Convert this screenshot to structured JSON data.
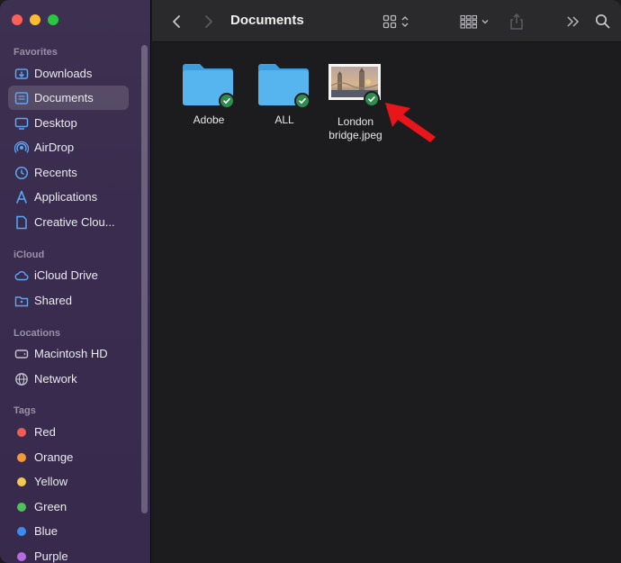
{
  "toolbar": {
    "title": "Documents"
  },
  "sidebar": {
    "sections": {
      "favorites": "Favorites",
      "icloud": "iCloud",
      "locations": "Locations",
      "tags": "Tags"
    },
    "favorites": [
      {
        "label": "Downloads",
        "icon": "download-icon"
      },
      {
        "label": "Documents",
        "icon": "document-icon",
        "selected": true
      },
      {
        "label": "Desktop",
        "icon": "desktop-icon"
      },
      {
        "label": "AirDrop",
        "icon": "airdrop-icon"
      },
      {
        "label": "Recents",
        "icon": "clock-icon"
      },
      {
        "label": "Applications",
        "icon": "applications-icon"
      },
      {
        "label": "Creative Clou...",
        "icon": "document-icon"
      }
    ],
    "icloud": [
      {
        "label": "iCloud Drive",
        "icon": "cloud-icon"
      },
      {
        "label": "Shared",
        "icon": "shared-folder-icon"
      }
    ],
    "locations": [
      {
        "label": "Macintosh HD",
        "icon": "disk-icon"
      },
      {
        "label": "Network",
        "icon": "globe-icon"
      }
    ],
    "tags": [
      {
        "label": "Red",
        "color": "#ee5d58"
      },
      {
        "label": "Orange",
        "color": "#f29a36"
      },
      {
        "label": "Yellow",
        "color": "#f2c94c"
      },
      {
        "label": "Green",
        "color": "#4fc15a"
      },
      {
        "label": "Blue",
        "color": "#3b8bf2"
      },
      {
        "label": "Purple",
        "color": "#b46de0"
      }
    ]
  },
  "files": [
    {
      "name": "Adobe",
      "kind": "folder"
    },
    {
      "name": "ALL",
      "kind": "folder"
    },
    {
      "name": "London bridge.jpeg",
      "kind": "image"
    }
  ],
  "colors": {
    "accent": "#0a84ff",
    "folder": "#4aaee8",
    "synced_badge": "#2e8c4e",
    "arrow": "#e8161b"
  }
}
